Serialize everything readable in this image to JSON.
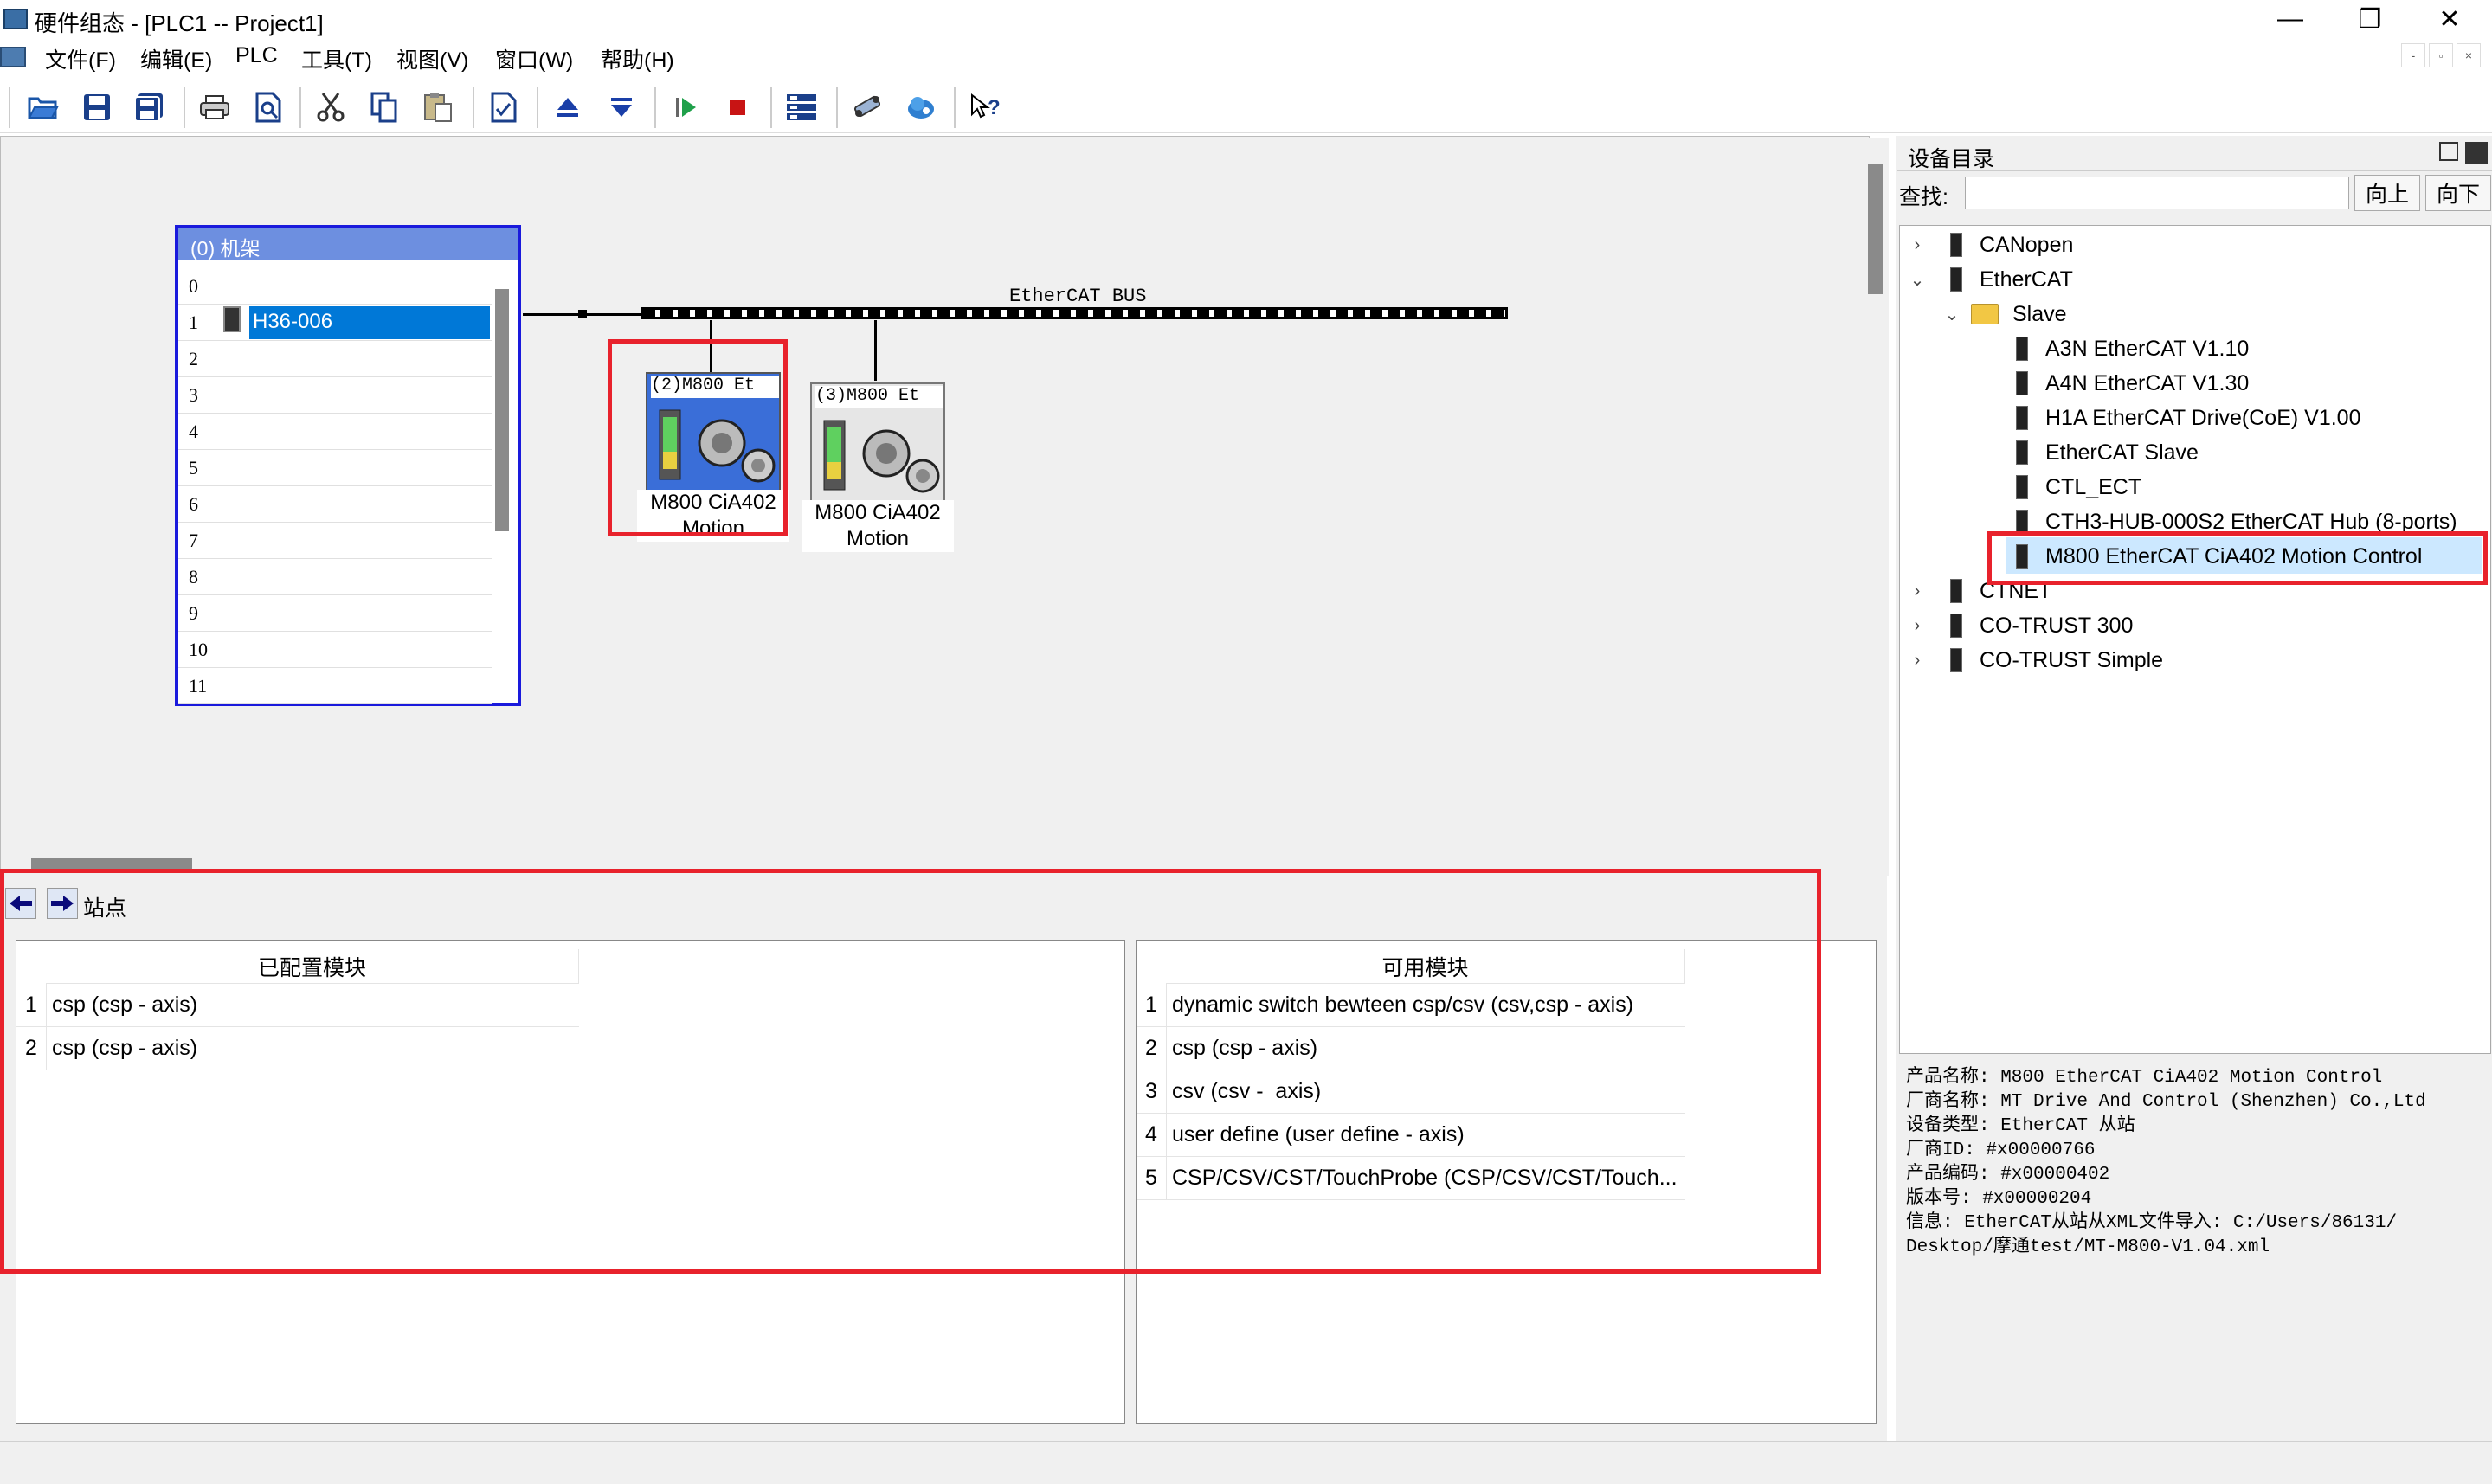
{
  "window": {
    "title": "硬件组态 - [PLC1 -- Project1]",
    "minimize": "—",
    "restore": "❐",
    "close": "✕"
  },
  "menu": {
    "items": [
      "文件(F)",
      "编辑(E)",
      "PLC",
      "工具(T)",
      "视图(V)",
      "窗口(W)",
      "帮助(H)"
    ],
    "mdi_min": "-",
    "mdi_restore": "▫",
    "mdi_close": "×"
  },
  "toolbar": {
    "icons": [
      "open-icon",
      "save-icon",
      "save-all-icon",
      "print-icon",
      "print-preview-icon",
      "cut-icon",
      "copy-icon",
      "paste-icon",
      "check-icon",
      "move-up-icon",
      "move-down-icon",
      "run-icon",
      "stop-icon",
      "list-icon",
      "network-icon",
      "cloud-icon",
      "help-icon"
    ]
  },
  "rack": {
    "header": "(0)  机架",
    "rows": [
      "0",
      "1",
      "2",
      "3",
      "4",
      "5",
      "6",
      "7",
      "8",
      "9",
      "10",
      "11"
    ],
    "selected_row": "1",
    "selected_module": "H36-006"
  },
  "bus": {
    "label": "EtherCAT BUS"
  },
  "devices": [
    {
      "tag": "(2)M800 Et",
      "label_line1": "M800 CiA402",
      "label_line2": "Motion",
      "selected": true
    },
    {
      "tag": "(3)M800 Et",
      "label_line1": "M800 CiA402",
      "label_line2": "Motion",
      "selected": false
    }
  ],
  "catalog": {
    "title": "设备目录",
    "search_label": "查找:",
    "search_value": "",
    "up_button": "向上",
    "down_button": "向下",
    "tree": [
      {
        "label": "CANopen",
        "level": 0,
        "expanded": false
      },
      {
        "label": "EtherCAT",
        "level": 0,
        "expanded": true
      },
      {
        "label": "Slave",
        "level": 1,
        "expanded": true,
        "folder": true
      },
      {
        "label": "A3N EtherCAT V1.10",
        "level": 2
      },
      {
        "label": "A4N EtherCAT V1.30",
        "level": 2
      },
      {
        "label": "H1A EtherCAT Drive(CoE) V1.00",
        "level": 2
      },
      {
        "label": "EtherCAT Slave",
        "level": 2
      },
      {
        "label": "CTL_ECT",
        "level": 2
      },
      {
        "label": "CTH3-HUB-000S2 EtherCAT Hub (8-ports)",
        "level": 2
      },
      {
        "label": "M800 EtherCAT CiA402 Motion Control",
        "level": 2,
        "selected": true
      },
      {
        "label": "CTNET",
        "level": 0,
        "expanded": false
      },
      {
        "label": "CO-TRUST 300",
        "level": 0,
        "expanded": false
      },
      {
        "label": "CO-TRUST Simple",
        "level": 0,
        "expanded": false
      }
    ],
    "info": [
      "产品名称: M800 EtherCAT CiA402 Motion Control",
      "厂商名称: MT Drive And Control (Shenzhen) Co.,Ltd",
      "设备类型: EtherCAT 从站",
      "厂商ID: #x00000766",
      "产品编码: #x00000402",
      "版本号: #x00000204",
      "信息: EtherCAT从站从XML文件导入: C:/Users/86131/",
      "Desktop/摩通test/MT-M800-V1.04.xml"
    ]
  },
  "station": {
    "label": "站点",
    "configured": {
      "header": "已配置模块",
      "rows": [
        {
          "num": "1",
          "name": "csp (csp - axis)"
        },
        {
          "num": "2",
          "name": "csp (csp - axis)"
        }
      ]
    },
    "available": {
      "header": "可用模块",
      "rows": [
        {
          "num": "1",
          "name": "dynamic switch bewteen csp/csv (csv,csp - axis)"
        },
        {
          "num": "2",
          "name": "csp (csp - axis)"
        },
        {
          "num": "3",
          "name": "csv (csv -  axis)"
        },
        {
          "num": "4",
          "name": "user define (user define - axis)"
        },
        {
          "num": "5",
          "name": "CSP/CSV/CST/TouchProbe (CSP/CSV/CST/Touch..."
        }
      ]
    }
  },
  "colors": {
    "highlight": "#e8222c",
    "rack_border": "#1a1adc",
    "rack_header": "#6d8fe0",
    "selection": "#0078d7",
    "tree_selection": "#cce8ff"
  }
}
